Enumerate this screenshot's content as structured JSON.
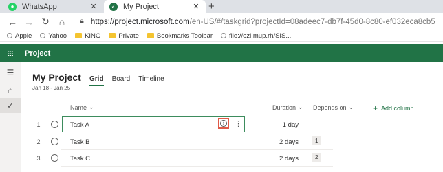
{
  "browser": {
    "tabs": [
      {
        "title": "WhatsApp",
        "favicon_color": "#25d366",
        "favicon": "whatsapp-icon"
      },
      {
        "title": "My Project",
        "favicon_color": "#217346",
        "favicon": "project-icon"
      }
    ],
    "url": {
      "host": "https://project.microsoft.com",
      "path": "/en-US/#/taskgrid?projectId=08adeec7-db7f-45d0-8c80-ef032eca8cb5"
    },
    "bookmarks": [
      {
        "label": "Apple",
        "icon": "apple-icon"
      },
      {
        "label": "Yahoo",
        "icon": "yahoo-icon"
      },
      {
        "label": "KING",
        "icon": "folder-icon"
      },
      {
        "label": "Private",
        "icon": "folder-icon"
      },
      {
        "label": "Bookmarks Toolbar",
        "icon": "folder-icon"
      },
      {
        "label": "file://ozi.mup.rh/SIS...",
        "icon": "globe-icon"
      }
    ]
  },
  "app": {
    "title": "Project",
    "accent": "#217346"
  },
  "project": {
    "title": "My Project",
    "dates": "Jan 18 - Jan 25",
    "views": [
      "Grid",
      "Board",
      "Timeline"
    ],
    "active_view": "Grid"
  },
  "grid": {
    "columns": {
      "name": "Name",
      "duration": "Duration",
      "depends_on": "Depends on",
      "add_column": "Add column"
    },
    "rows": [
      {
        "num": "1",
        "name": "Task A",
        "duration": "1 day",
        "depends_on": ""
      },
      {
        "num": "2",
        "name": "Task B",
        "duration": "2 days",
        "depends_on": "1"
      },
      {
        "num": "3",
        "name": "Task C",
        "duration": "2 days",
        "depends_on": "2"
      }
    ],
    "highlight_color": "#e05a47"
  }
}
